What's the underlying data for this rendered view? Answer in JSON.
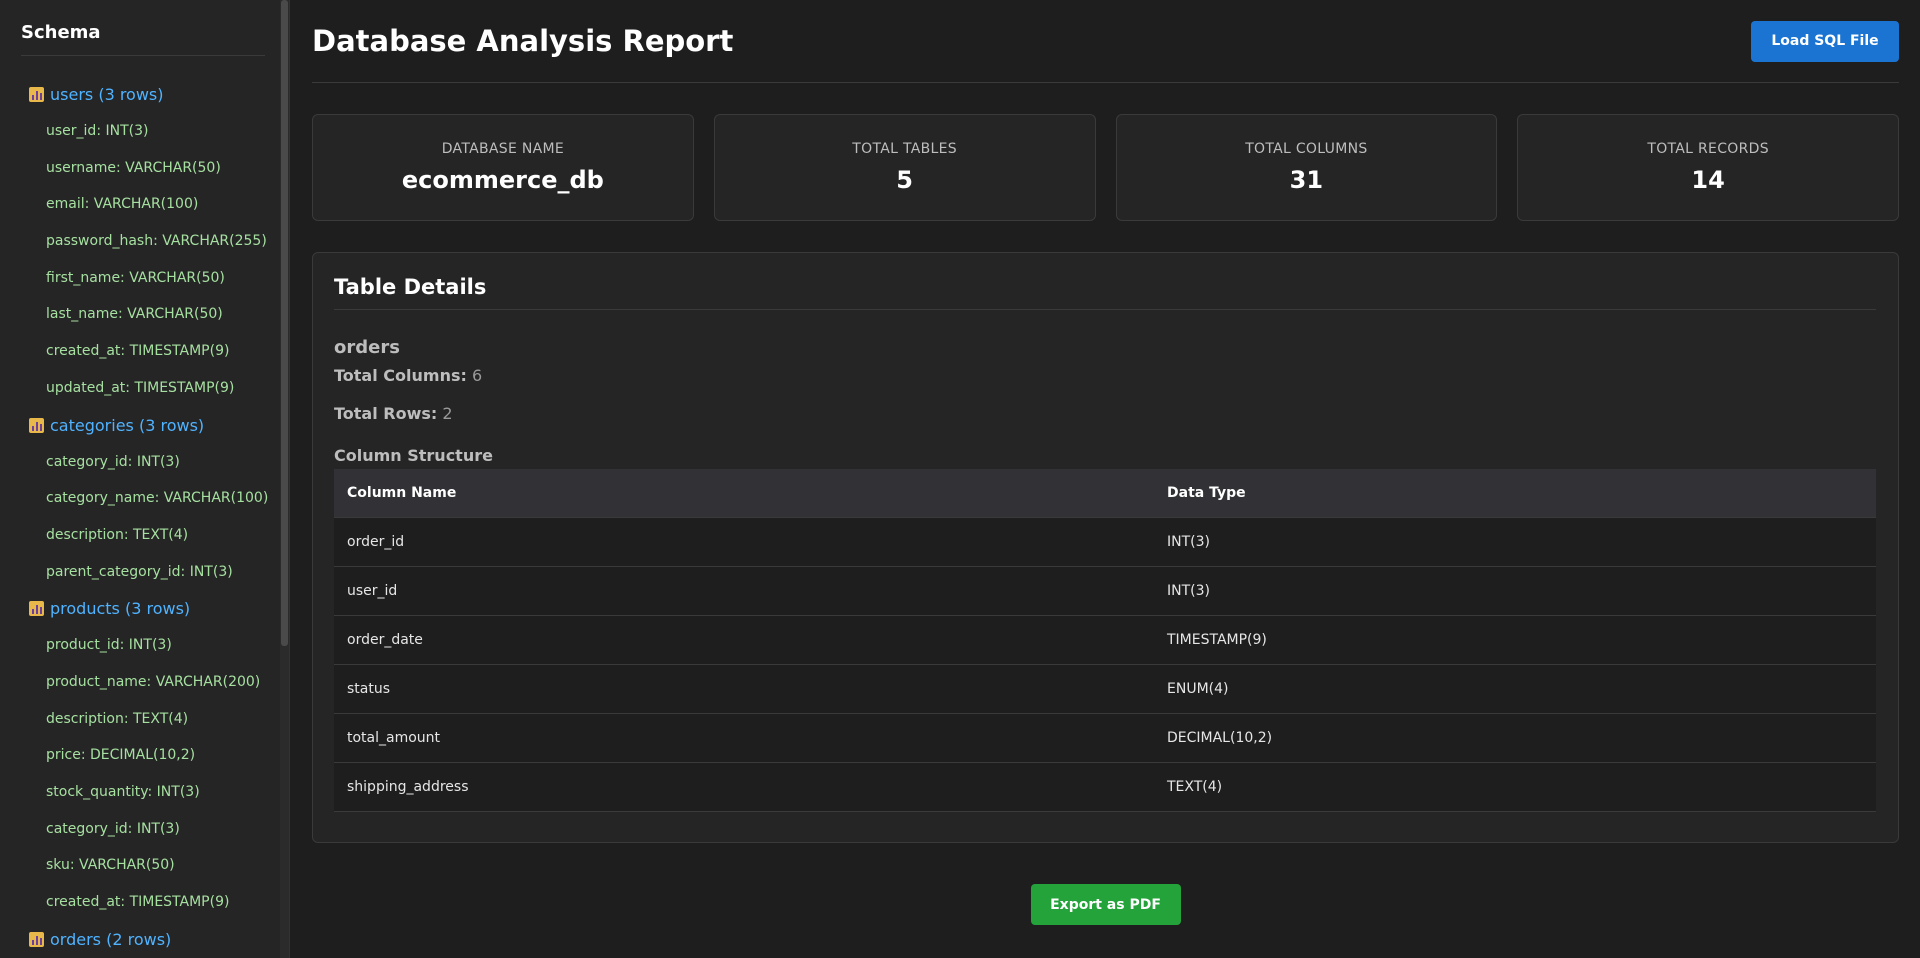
{
  "sidebar": {
    "title": "Schema",
    "tables": [
      {
        "label": "users (3 rows)",
        "columns": [
          "user_id: INT(3)",
          "username: VARCHAR(50)",
          "email: VARCHAR(100)",
          "password_hash: VARCHAR(255)",
          "first_name: VARCHAR(50)",
          "last_name: VARCHAR(50)",
          "created_at: TIMESTAMP(9)",
          "updated_at: TIMESTAMP(9)"
        ]
      },
      {
        "label": "categories (3 rows)",
        "columns": [
          "category_id: INT(3)",
          "category_name: VARCHAR(100)",
          "description: TEXT(4)",
          "parent_category_id: INT(3)"
        ]
      },
      {
        "label": "products (3 rows)",
        "columns": [
          "product_id: INT(3)",
          "product_name: VARCHAR(200)",
          "description: TEXT(4)",
          "price: DECIMAL(10,2)",
          "stock_quantity: INT(3)",
          "category_id: INT(3)",
          "sku: VARCHAR(50)",
          "created_at: TIMESTAMP(9)"
        ]
      },
      {
        "label": "orders (2 rows)",
        "columns": []
      }
    ]
  },
  "header": {
    "title": "Database Analysis Report",
    "load_button": "Load SQL File"
  },
  "stats": [
    {
      "label": "DATABASE NAME",
      "value": "ecommerce_db"
    },
    {
      "label": "TOTAL TABLES",
      "value": "5"
    },
    {
      "label": "TOTAL COLUMNS",
      "value": "31"
    },
    {
      "label": "TOTAL RECORDS",
      "value": "14"
    }
  ],
  "details": {
    "title": "Table Details",
    "table_name": "orders",
    "total_columns_label": "Total Columns:",
    "total_columns_value": "6",
    "total_rows_label": "Total Rows:",
    "total_rows_value": "2",
    "structure_title": "Column Structure",
    "headers": [
      "Column Name",
      "Data Type"
    ],
    "rows": [
      [
        "order_id",
        "INT(3)"
      ],
      [
        "user_id",
        "INT(3)"
      ],
      [
        "order_date",
        "TIMESTAMP(9)"
      ],
      [
        "status",
        "ENUM(4)"
      ],
      [
        "total_amount",
        "DECIMAL(10,2)"
      ],
      [
        "shipping_address",
        "TEXT(4)"
      ]
    ]
  },
  "export_button": "Export as PDF",
  "colors": {
    "accent_blue": "#1b74d1",
    "accent_green": "#23a33a",
    "table_link": "#4fb3ff",
    "column_text": "#a6e0a0"
  },
  "icons": {
    "table_icon": "bar-chart-icon"
  }
}
